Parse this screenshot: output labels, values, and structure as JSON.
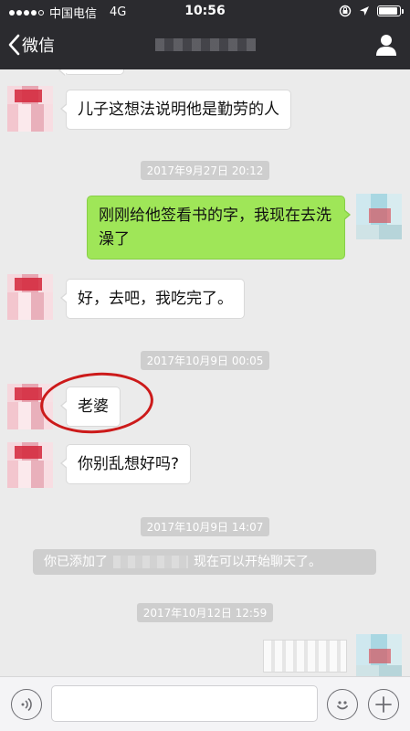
{
  "status_bar": {
    "carrier": "中国电信",
    "network": "4G",
    "time": "10:56",
    "signal_bars": 5,
    "signal_filled": 4,
    "battery_level": 0.9
  },
  "nav": {
    "back_label": "微信",
    "back_icon": "chevron-left-icon",
    "profile_icon": "person-icon"
  },
  "messages": [
    {
      "side": "left",
      "text": "儿子这想法说明他是勤劳的人"
    },
    {
      "side": "timestamp",
      "text": "2017年9月27日 20:12"
    },
    {
      "side": "right",
      "text": "刚刚给他签看书的字，我现在去洗澡了"
    },
    {
      "side": "left",
      "text": "好，去吧，我吃完了。"
    },
    {
      "side": "timestamp",
      "text": "2017年10月9日 00:05"
    },
    {
      "side": "left",
      "text": "老婆"
    },
    {
      "side": "left",
      "text": "你别乱想好吗?"
    },
    {
      "side": "timestamp",
      "text": "2017年10月9日 14:07"
    },
    {
      "side": "system",
      "prefix": "你已添加了",
      "suffix": "现在可以开始聊天了。"
    },
    {
      "side": "timestamp",
      "text": "2017年10月12日 12:59"
    }
  ],
  "input_bar": {
    "voice_icon": "voice-icon",
    "emoji_icon": "emoji-icon",
    "plus_icon": "plus-icon",
    "placeholder": ""
  },
  "colors": {
    "bar": "#2b2b2f",
    "chat_bg": "#ebebeb",
    "my_bubble": "#9fe658",
    "annotation": "#cc1a1a"
  }
}
